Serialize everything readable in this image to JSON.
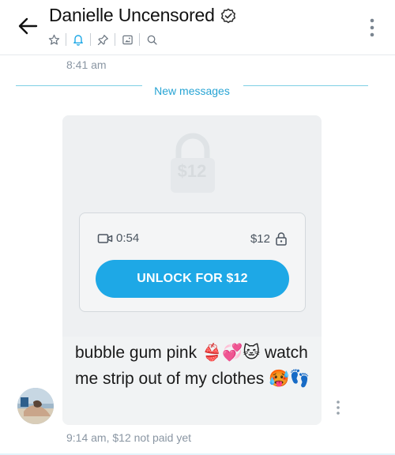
{
  "header": {
    "title": "Danielle Uncensored",
    "verified_icon": "verified-badge-icon",
    "icons": [
      "star-icon",
      "bell-icon",
      "pin-icon",
      "gallery-icon",
      "search-icon"
    ],
    "accent_color": "#27a4d4"
  },
  "chat": {
    "first_time": "8:41 am",
    "new_messages_label": "New messages",
    "message": {
      "locked_price_ghost": "$12",
      "media_duration": "0:54",
      "media_price": "$12",
      "unlock_label": "UNLOCK FOR $12",
      "text": "bubble gum pink 👙💞🐱 watch me strip out of my clothes 🥵👣",
      "time": "9:14 am,",
      "status": "$12 not paid yet"
    }
  },
  "colors": {
    "unlock_button": "#1ea8e6",
    "bubble": "#f1f3f4",
    "meta_text": "#8a96a3"
  }
}
